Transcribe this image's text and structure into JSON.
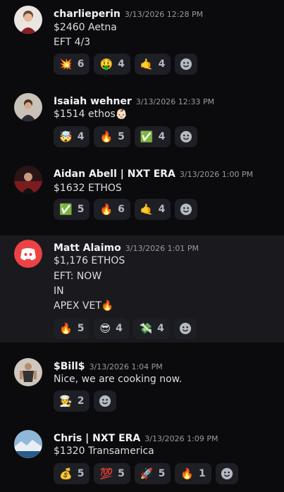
{
  "messages": [
    {
      "username": "charlieperin",
      "timestamp": "3/13/2026 12:28 PM",
      "lines": [
        "$2460 Aetna",
        "EFT 4/3"
      ],
      "reactions": [
        {
          "emoji": "💥",
          "icon": "collision-emoji-icon",
          "count": "6"
        },
        {
          "emoji": "🤑",
          "icon": "money-mouth-emoji-icon",
          "count": "4"
        },
        {
          "emoji": "🤙",
          "icon": "call-me-hand-emoji-icon",
          "count": "4"
        }
      ]
    },
    {
      "username": "Isaiah wehner",
      "timestamp": "3/13/2026 12:33 PM",
      "lines": [
        "$1514 ethos👶🏻"
      ],
      "reactions": [
        {
          "emoji": "🤯",
          "icon": "exploding-head-emoji-icon",
          "count": "4"
        },
        {
          "emoji": "🔥",
          "icon": "fire-emoji-icon",
          "count": "5"
        },
        {
          "emoji": "✅",
          "icon": "check-mark-emoji-icon",
          "count": "4"
        }
      ]
    },
    {
      "username": "Aidan Abell | NXT ERA",
      "timestamp": "3/13/2026 1:00 PM",
      "lines": [
        "$1632 ETHOS"
      ],
      "reactions": [
        {
          "emoji": "✅",
          "icon": "check-mark-emoji-icon",
          "count": "5"
        },
        {
          "emoji": "🔥",
          "icon": "fire-emoji-icon",
          "count": "6"
        },
        {
          "emoji": "🤙",
          "icon": "call-me-hand-emoji-icon",
          "count": "4"
        }
      ]
    },
    {
      "username": "Matt Alaimo",
      "timestamp": "3/13/2026 1:01 PM",
      "lines": [
        "$1,176 ETHOS",
        "EFT: NOW",
        "IN",
        "APEX VET🔥"
      ],
      "reactions": [
        {
          "emoji": "🔥",
          "icon": "fire-emoji-icon",
          "count": "5"
        },
        {
          "emoji": "😎",
          "icon": "sunglasses-emoji-icon",
          "count": "4"
        },
        {
          "emoji": "💸",
          "icon": "money-with-wings-emoji-icon",
          "count": "4"
        }
      ]
    },
    {
      "username": "$Bill$",
      "timestamp": "3/13/2026 1:04 PM",
      "lines": [
        "Nice, we are cooking now."
      ],
      "reactions": [
        {
          "emoji": "🧑‍🍳",
          "icon": "cook-emoji-icon",
          "count": "2"
        }
      ]
    },
    {
      "username": "Chris | NXT ERA",
      "timestamp": "3/13/2026 1:09 PM",
      "lines": [
        "$1320 Transamerica"
      ],
      "reactions": [
        {
          "emoji": "💰",
          "icon": "money-bag-emoji-icon",
          "count": "5"
        },
        {
          "emoji": "💯",
          "icon": "hundred-points-emoji-icon",
          "count": "5"
        },
        {
          "emoji": "🚀",
          "icon": "rocket-emoji-icon",
          "count": "5"
        },
        {
          "emoji": "🔥",
          "icon": "fire-emoji-icon",
          "count": "1"
        }
      ]
    }
  ],
  "colors": {
    "background": "#0b0b0d",
    "highlight_row": "#1a1a1e",
    "reaction_bg": "#1e1f24",
    "discord_blurple_red": "#ed4245"
  }
}
